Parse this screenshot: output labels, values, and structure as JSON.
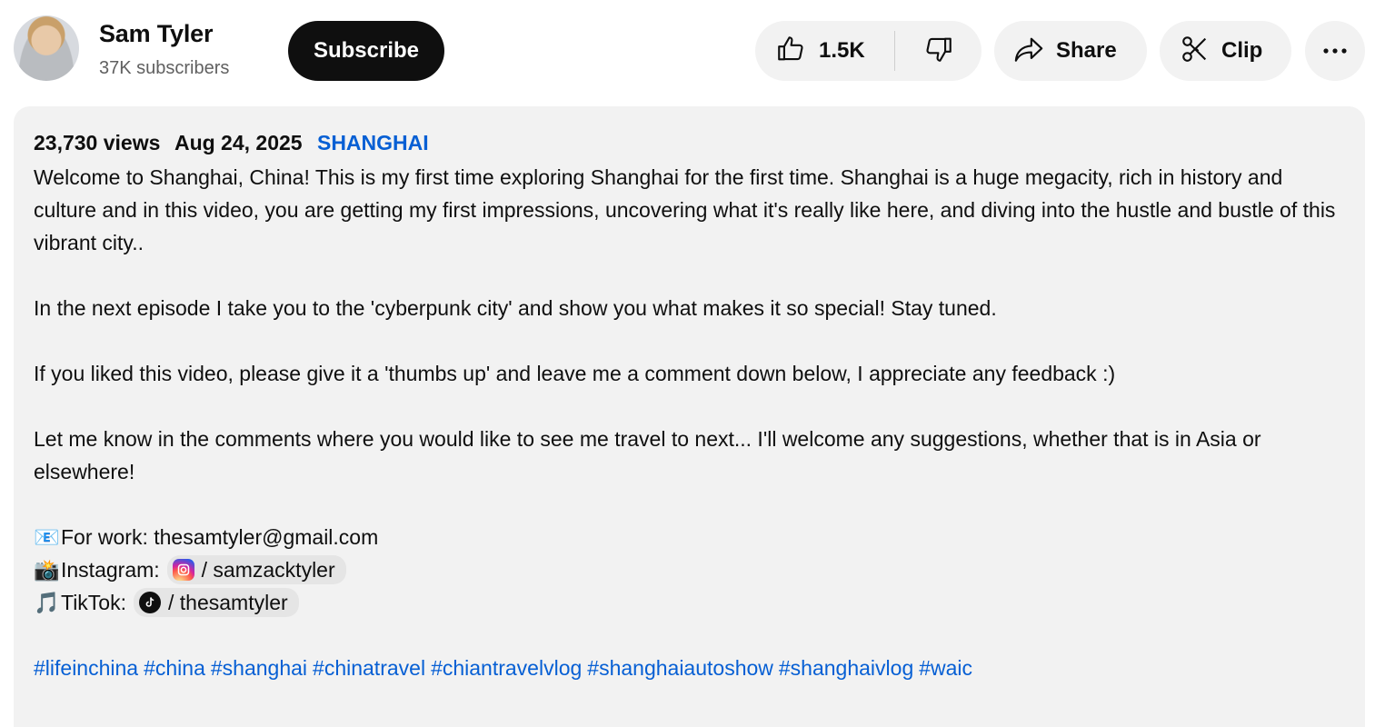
{
  "channel": {
    "name": "Sam Tyler",
    "subscribers": "37K subscribers",
    "subscribe_label": "Subscribe"
  },
  "actions": {
    "like_count": "1.5K",
    "share_label": "Share",
    "clip_label": "Clip"
  },
  "description": {
    "views": "23,730 views",
    "date": "Aug 24, 2025",
    "location": "SHANGHAI",
    "paragraph1": "Welcome to Shanghai, China! This is my first time exploring Shanghai for the first time. Shanghai is a huge megacity, rich in history and culture and in this video, you are getting my first impressions, uncovering what it's really like here, and diving into the hustle and bustle of this vibrant city..",
    "paragraph2": "In the next episode I take you to the 'cyberpunk city' and show you what makes it so special! Stay tuned.",
    "paragraph3": "If you liked this video, please give it a 'thumbs up' and leave me a comment down below, I appreciate any feedback :)",
    "paragraph4": "Let me know in the comments where you would like to see me travel to next... I'll welcome any suggestions, whether that is in Asia or elsewhere!",
    "work_emoji": "📧",
    "work_line": "For work: thesamtyler@gmail.com",
    "instagram_emoji": "📸",
    "instagram_label": "Instagram:",
    "instagram_handle": "/ samzacktyler",
    "tiktok_emoji": "🎵",
    "tiktok_label": "TikTok:",
    "tiktok_handle": "/ thesamtyler",
    "hashtags": [
      "#lifeinchina",
      "#china",
      "#shanghai",
      "#chinatravel",
      "#chiantravelvlog",
      "#shanghaiautoshow",
      "#shanghaivlog",
      "#waic"
    ]
  },
  "icons": {
    "like": "thumbs-up-icon",
    "dislike": "thumbs-down-icon",
    "share": "share-arrow-icon",
    "clip": "scissors-icon",
    "more": "more-horizontal-icon"
  },
  "colors": {
    "link": "#065fd4",
    "subscribe_bg": "#0f0f0f",
    "pill_bg": "#f2f2f2"
  }
}
